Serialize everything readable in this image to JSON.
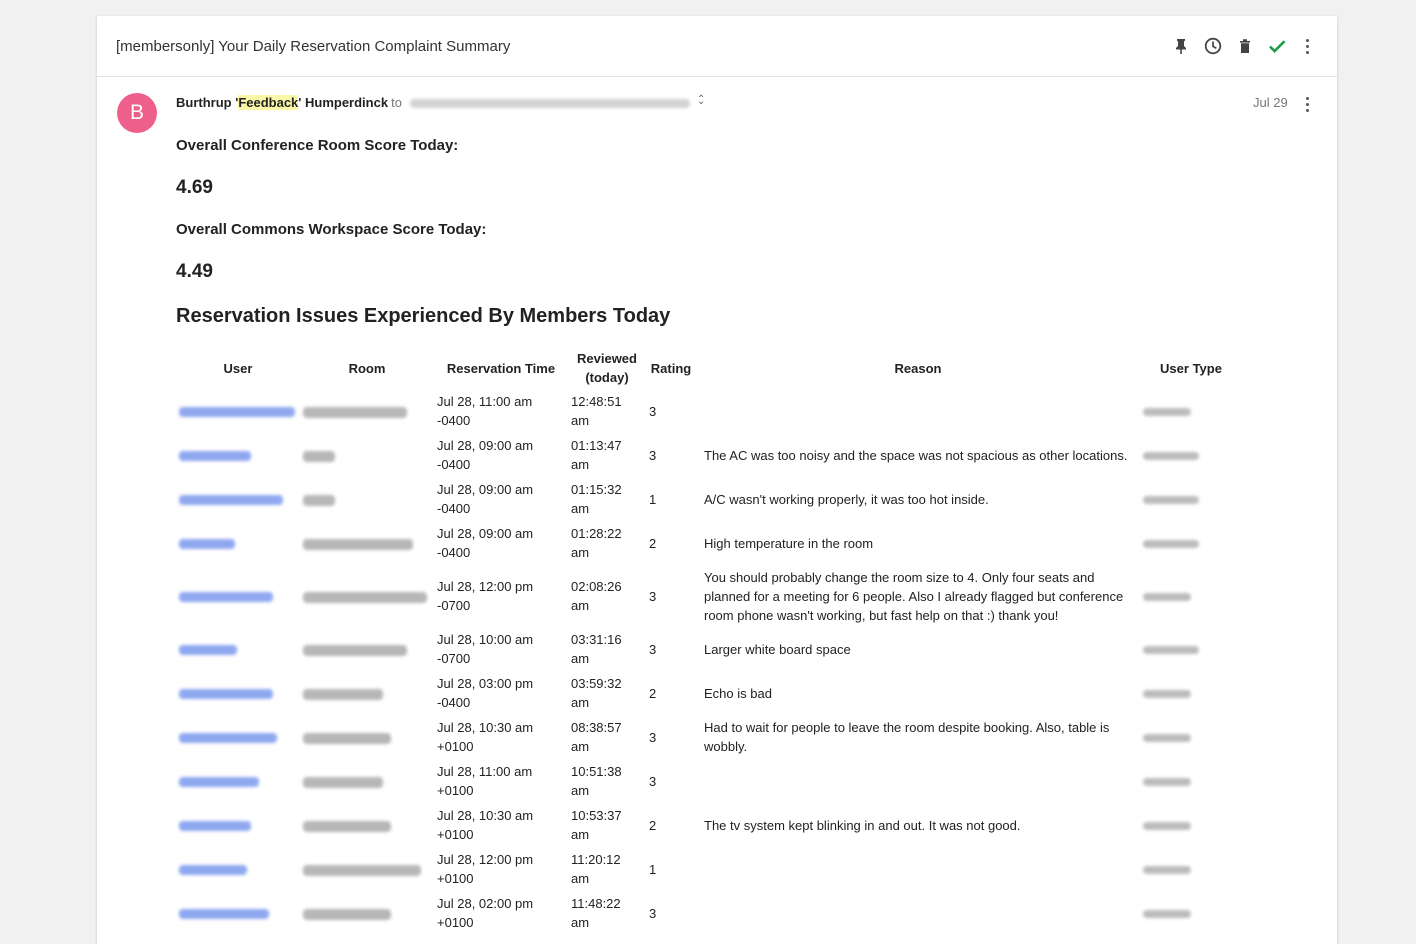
{
  "email": {
    "subject": "[membersonly] Your Daily Reservation Complaint Summary",
    "sender": {
      "pre": "Burthrup '",
      "highlight": "Feedback",
      "post": "' Humperdinck"
    },
    "to_label": "to",
    "date": "Jul 29"
  },
  "header_icons": [
    "pin-icon",
    "clock-icon",
    "trash-icon",
    "check-icon",
    "more-vert-icon"
  ],
  "avatar_letter": "B",
  "accent_colors": {
    "avatar": "#ef5f8c",
    "check": "#1e9e4a",
    "link": "#4a6ee0"
  },
  "body": {
    "conf_label": "Overall Conference Room Score Today:",
    "conf_score": "4.69",
    "commons_label": "Overall Commons Workspace Score Today:",
    "commons_score": "4.49",
    "section_title": "Reservation Issues Experienced By Members Today"
  },
  "table": {
    "headers": {
      "user": "User",
      "room": "Room",
      "time": "Reservation Time",
      "reviewed_line1": "Reviewed",
      "reviewed_line2": "(today)",
      "rating": "Rating",
      "reason": "Reason",
      "user_type": "User Type"
    },
    "rows": [
      {
        "time1": "Jul 28, 11:00 am",
        "time2": "-0400",
        "rev1": "12:48:51",
        "rev2": "am",
        "rating": "3",
        "reason": ""
      },
      {
        "time1": "Jul 28, 09:00 am",
        "time2": "-0400",
        "rev1": "01:13:47",
        "rev2": "am",
        "rating": "3",
        "reason": "The AC was too noisy and the space was not spacious as other locations."
      },
      {
        "time1": "Jul 28, 09:00 am",
        "time2": "-0400",
        "rev1": "01:15:32",
        "rev2": "am",
        "rating": "1",
        "reason": "A/C wasn't working properly, it was too hot inside."
      },
      {
        "time1": "Jul 28, 09:00 am",
        "time2": "-0400",
        "rev1": "01:28:22",
        "rev2": "am",
        "rating": "2",
        "reason": "High temperature in the room"
      },
      {
        "time1": "Jul 28, 12:00 pm",
        "time2": "-0700",
        "rev1": "02:08:26",
        "rev2": "am",
        "rating": "3",
        "reason": "You should probably change the room size to 4. Only four seats and planned for a meeting for 6 people. Also I already flagged but conference room phone wasn't working, but fast help on that :) thank you!"
      },
      {
        "time1": "Jul 28, 10:00 am",
        "time2": "-0700",
        "rev1": "03:31:16",
        "rev2": "am",
        "rating": "3",
        "reason": "Larger white board space"
      },
      {
        "time1": "Jul 28, 03:00 pm",
        "time2": "-0400",
        "rev1": "03:59:32",
        "rev2": "am",
        "rating": "2",
        "reason": "Echo is bad"
      },
      {
        "time1": "Jul 28, 10:30 am",
        "time2": "+0100",
        "rev1": "08:38:57",
        "rev2": "am",
        "rating": "3",
        "reason": "Had to wait for people to leave the room despite booking. Also, table is wobbly."
      },
      {
        "time1": "Jul 28, 11:00 am",
        "time2": "+0100",
        "rev1": "10:51:38",
        "rev2": "am",
        "rating": "3",
        "reason": ""
      },
      {
        "time1": "Jul 28, 10:30 am",
        "time2": "+0100",
        "rev1": "10:53:37",
        "rev2": "am",
        "rating": "2",
        "reason": "The tv system kept blinking in and out. It was not good."
      },
      {
        "time1": "Jul 28, 12:00 pm",
        "time2": "+0100",
        "rev1": "11:20:12",
        "rev2": "am",
        "rating": "1",
        "reason": ""
      },
      {
        "time1": "Jul 28, 02:00 pm",
        "time2": "+0100",
        "rev1": "11:48:22",
        "rev2": "am",
        "rating": "3",
        "reason": ""
      }
    ]
  }
}
